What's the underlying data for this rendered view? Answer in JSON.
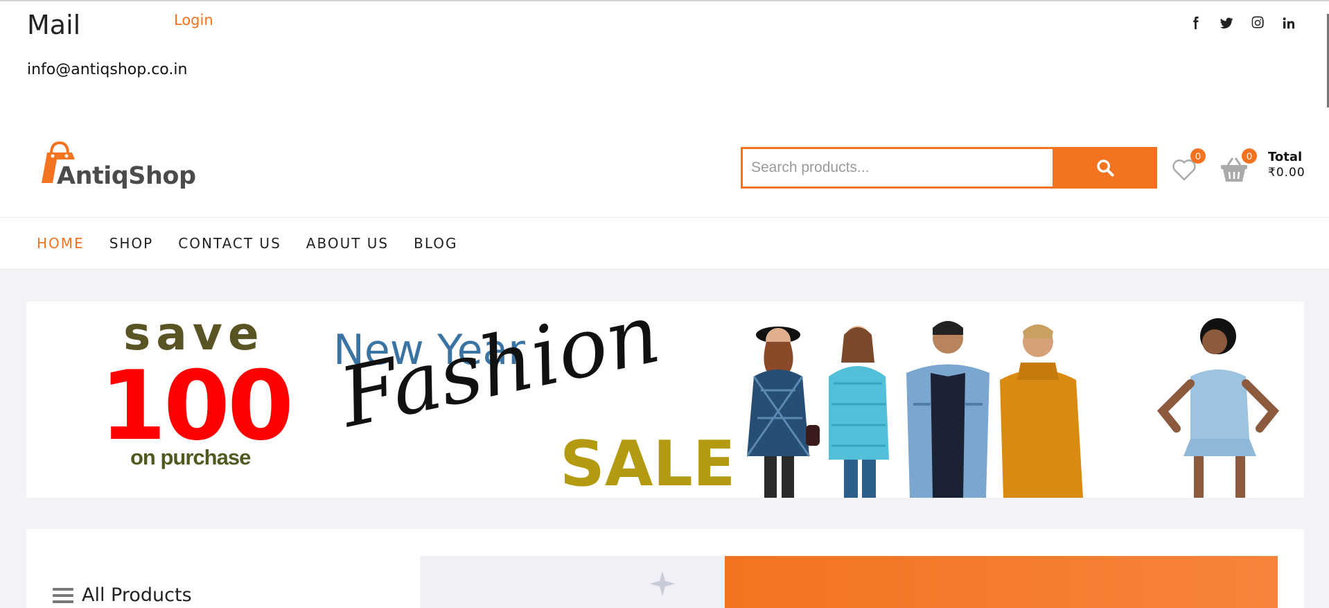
{
  "topbar": {
    "mail_title": "Mail",
    "login_label": "Login",
    "email": "info@antiqshop.co.in",
    "socials": [
      {
        "icon": "facebook-icon",
        "glyph": "f"
      },
      {
        "icon": "twitter-icon",
        "glyph": ""
      },
      {
        "icon": "instagram-icon",
        "glyph": ""
      },
      {
        "icon": "linkedin-icon",
        "glyph": "in"
      }
    ]
  },
  "header": {
    "logo_text": "AntiqShop",
    "search_placeholder": "Search products...",
    "wishlist_count": "0",
    "cart_count": "0",
    "total_label": "Total",
    "total_amount": "₹0.00"
  },
  "nav": {
    "items": [
      "HOME",
      "SHOP",
      "CONTACT US",
      "ABOUT US",
      "BLOG"
    ],
    "active_index": 0
  },
  "banner": {
    "save": "save",
    "amount": "100",
    "on_purchase": "on purchase",
    "new_year": "New Year",
    "fashion": "Fashion",
    "sale": "SALE"
  },
  "lower": {
    "all_products_label": "All Products"
  },
  "colors": {
    "accent": "#f47321",
    "banner_red": "#ff0000",
    "banner_olive": "#5a5424",
    "banner_blue": "#3b74a3",
    "banner_gold": "#b49a10"
  }
}
